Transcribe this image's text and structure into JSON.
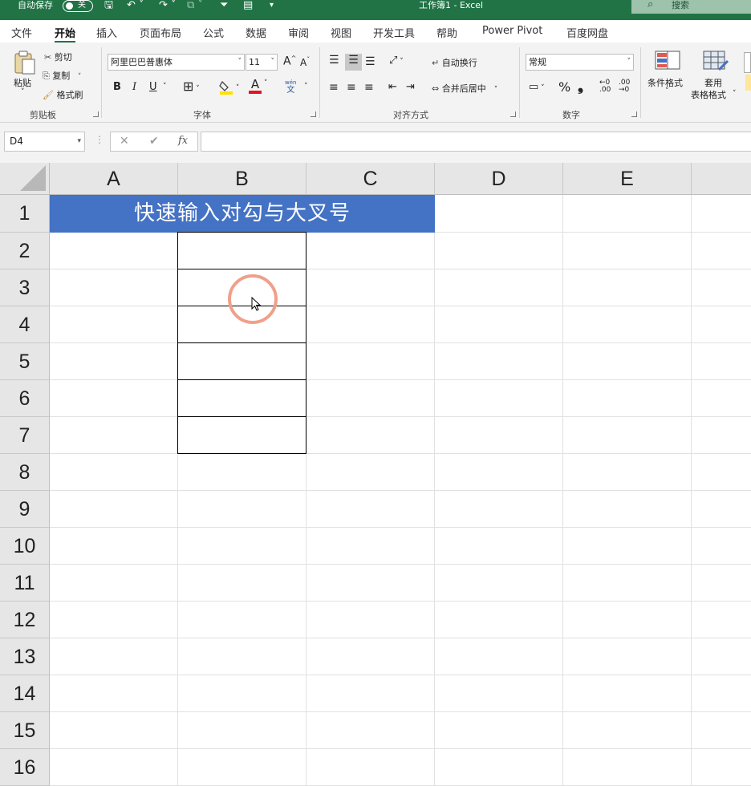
{
  "titlebar": {
    "autosave_label": "自动保存",
    "autosave_state": "关",
    "document_title": "工作簿1  -  Excel",
    "search_placeholder": "搜索"
  },
  "ribbon_tabs": [
    "文件",
    "开始",
    "插入",
    "页面布局",
    "公式",
    "数据",
    "审阅",
    "视图",
    "开发工具",
    "帮助",
    "Power Pivot",
    "百度网盘"
  ],
  "active_tab": "开始",
  "clipboard": {
    "paste": "粘贴",
    "cut": "剪切",
    "copy": "复制",
    "format_painter": "格式刷",
    "group_label": "剪贴板"
  },
  "font": {
    "name": "阿里巴巴普惠体",
    "size": "11",
    "bold": "B",
    "italic": "I",
    "underline": "U",
    "font_color_glyph": "A",
    "phonetic_top": "wén",
    "phonetic_bottom": "文",
    "grow_glyph": "A",
    "shrink_glyph": "A",
    "group_label": "字体"
  },
  "alignment": {
    "wrap_text": "自动换行",
    "merge_center": "合并后居中",
    "group_label": "对齐方式"
  },
  "number": {
    "format": "常规",
    "percent": "%",
    "comma": "❟",
    "group_label": "数字"
  },
  "styles": {
    "conditional_format": "条件格式",
    "table_format_line1": "套用",
    "table_format_line2": "表格格式"
  },
  "formula_bar": {
    "name_box": "D4",
    "cancel": "✕",
    "enter": "✔",
    "fx": "fx",
    "formula": ""
  },
  "sheet": {
    "columns": [
      "A",
      "B",
      "C",
      "D",
      "E"
    ],
    "rows": [
      "1",
      "2",
      "3",
      "4",
      "5",
      "6",
      "7",
      "8",
      "9",
      "10",
      "11",
      "12",
      "13",
      "14",
      "15",
      "16"
    ],
    "title_cell_text": "快速输入对勾与大叉号",
    "title_cell_color": "#4472c4"
  },
  "colors": {
    "excel_green": "#217346",
    "click_ring": "#f0a08a"
  }
}
